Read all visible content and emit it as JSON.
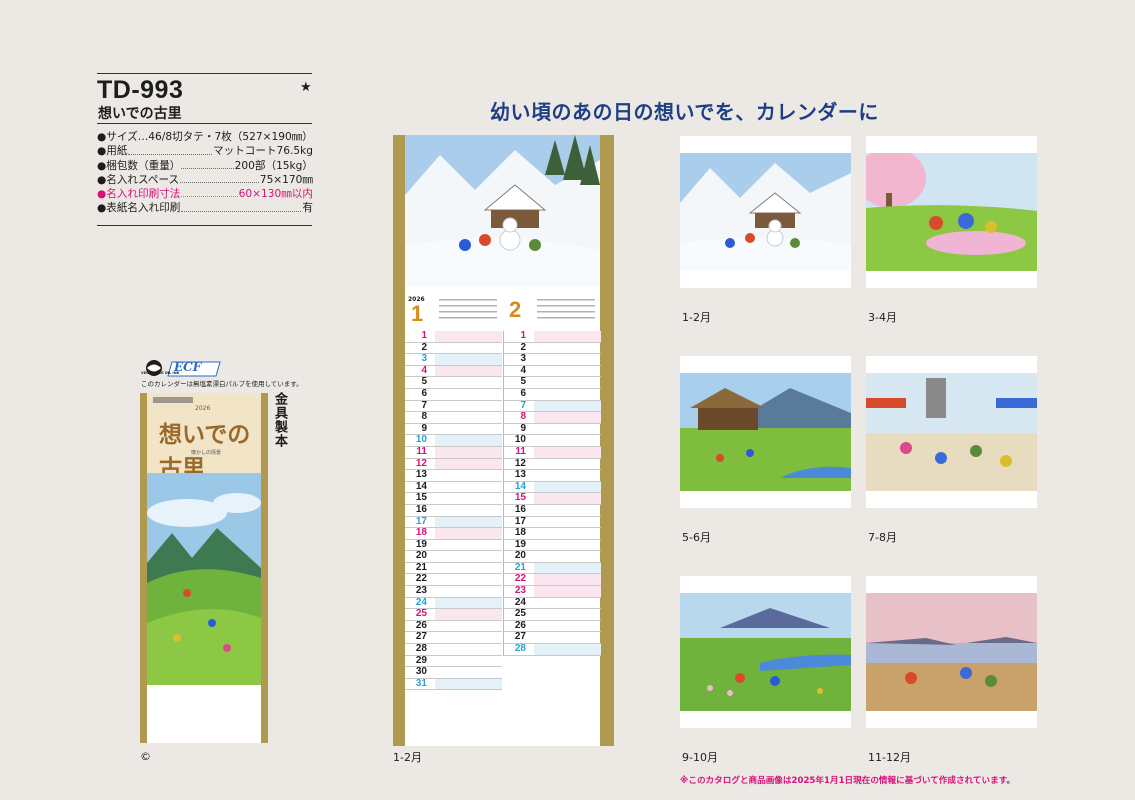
{
  "product": {
    "code": "TD-993",
    "star": "★",
    "name": "想いでの古里"
  },
  "specs": [
    {
      "label": "●サイズ…46/8切タテ・7枚（527×190㎜）",
      "value": "",
      "pink": false
    },
    {
      "label": "●用紙",
      "value": "マットコート76.5kg",
      "pink": false
    },
    {
      "label": "●梱包数（重量）",
      "value": "200部（15kg）",
      "pink": false
    },
    {
      "label": "●名入れスペース",
      "value": "75×170㎜",
      "pink": false
    },
    {
      "label": "●名入れ印刷寸法",
      "value": "60×130㎜以内",
      "pink": true
    },
    {
      "label": "●表紙名入れ印刷",
      "value": "有",
      "pink": false
    }
  ],
  "ecf": {
    "label": "ECF",
    "badge": "VEGETABLE OIL INK",
    "note": "このカレンダーは無塩素漂白パルプを使用しています。"
  },
  "small_calendar": {
    "year": "2026",
    "title": "想いでの古里",
    "subtitle": "懐かしの情景",
    "binding": "金具製本"
  },
  "copyright": "©",
  "headline": "幼い頃のあの日の想いでを、カレンダーに",
  "main_calendar": {
    "year": "2026",
    "month1": "1",
    "month2": "2",
    "caption": "1-2月",
    "jan_days": [
      "1",
      "2",
      "3",
      "4",
      "5",
      "6",
      "7",
      "8",
      "9",
      "10",
      "11",
      "12",
      "13",
      "14",
      "15",
      "16",
      "17",
      "18",
      "19",
      "20",
      "21",
      "22",
      "23",
      "24",
      "25",
      "26",
      "27",
      "28",
      "29",
      "30",
      "31"
    ],
    "feb_days": [
      "1",
      "2",
      "3",
      "4",
      "5",
      "6",
      "7",
      "8",
      "9",
      "10",
      "11",
      "12",
      "13",
      "14",
      "15",
      "16",
      "17",
      "18",
      "19",
      "20",
      "21",
      "22",
      "23",
      "24",
      "25",
      "26",
      "27",
      "28"
    ]
  },
  "thumbnails": [
    {
      "caption": "1-2月"
    },
    {
      "caption": "3-4月"
    },
    {
      "caption": "5-6月"
    },
    {
      "caption": "7-8月"
    },
    {
      "caption": "9-10月"
    },
    {
      "caption": "11-12月"
    }
  ],
  "footnote": "※このカタログと商品画像は2025年1月1日現在の情報に基づいて作成されています。",
  "colors": {
    "sunday": "#d8107a",
    "saturday": "#2a9fd6",
    "frame": "#b09a4f",
    "headline": "#1e3f86"
  }
}
